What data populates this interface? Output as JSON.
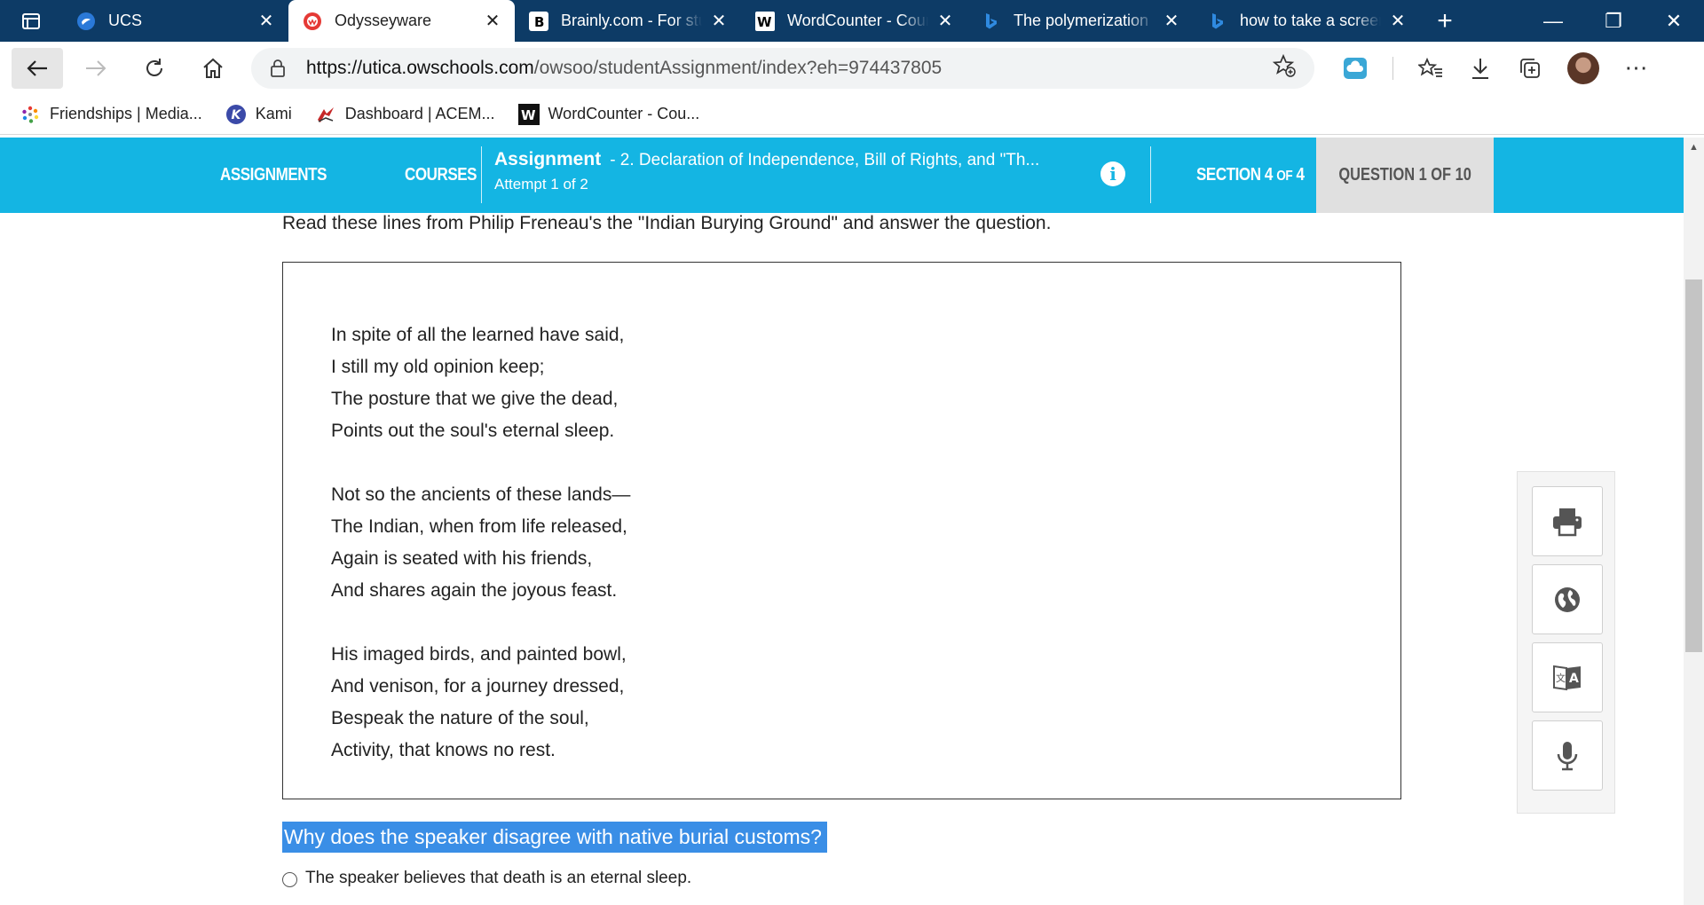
{
  "browser": {
    "tabs": [
      {
        "title": "UCS",
        "active": false
      },
      {
        "title": "Odysseyware",
        "active": true
      },
      {
        "title": "Brainly.com - For students",
        "active": false
      },
      {
        "title": "WordCounter - Count Words",
        "active": false
      },
      {
        "title": "The polymerization",
        "active": false
      },
      {
        "title": "how to take a screenshot",
        "active": false
      }
    ],
    "url_domain": "https://utica.owschools.com",
    "url_path": "/owsoo/studentAssignment/index?eh=974437805",
    "bookmarks": [
      {
        "label": "Friendships | Media...",
        "icon": "friendships-icon"
      },
      {
        "label": "Kami",
        "icon": "kami-icon"
      },
      {
        "label": "Dashboard | ACEM...",
        "icon": "dashboard-icon"
      },
      {
        "label": "WordCounter - Cou...",
        "icon": "wordcounter-icon"
      }
    ]
  },
  "header": {
    "nav_assignments": "ASSIGNMENTS",
    "nav_courses": "COURSES",
    "assignment_label": "Assignment",
    "assignment_title": "- 2. Declaration of Independence, Bill of Rights, and \"Th...",
    "attempt": "Attempt 1 of 2",
    "section_prefix": "SECTION 4",
    "section_of": "OF",
    "section_total": "4",
    "question_prefix": "QUESTION 1",
    "question_of": "OF",
    "question_total": "10",
    "accent_color": "#14b5e3"
  },
  "content": {
    "intro": "Read these lines from Philip Freneau's the \"Indian Burying Ground\" and answer the question.",
    "stanzas": [
      [
        "In spite of all the learned have said,",
        "I still my old opinion keep;",
        "The posture that we give the dead,",
        "Points out the soul's eternal sleep."
      ],
      [
        "Not so the ancients of these lands—",
        "The Indian, when from life released,",
        "Again is seated with his friends,",
        "And shares again the joyous feast."
      ],
      [
        "His imaged birds, and painted bowl,",
        "And venison, for a journey dressed,",
        "Bespeak the nature of the soul,",
        "Activity, that knows no rest."
      ]
    ],
    "question": "Why does the speaker disagree with native burial customs?",
    "answers": [
      {
        "label": "The speaker believes that death is an eternal sleep.",
        "selected": false
      }
    ]
  },
  "tools": [
    "print-icon",
    "globe-icon",
    "translate-icon",
    "microphone-icon"
  ]
}
